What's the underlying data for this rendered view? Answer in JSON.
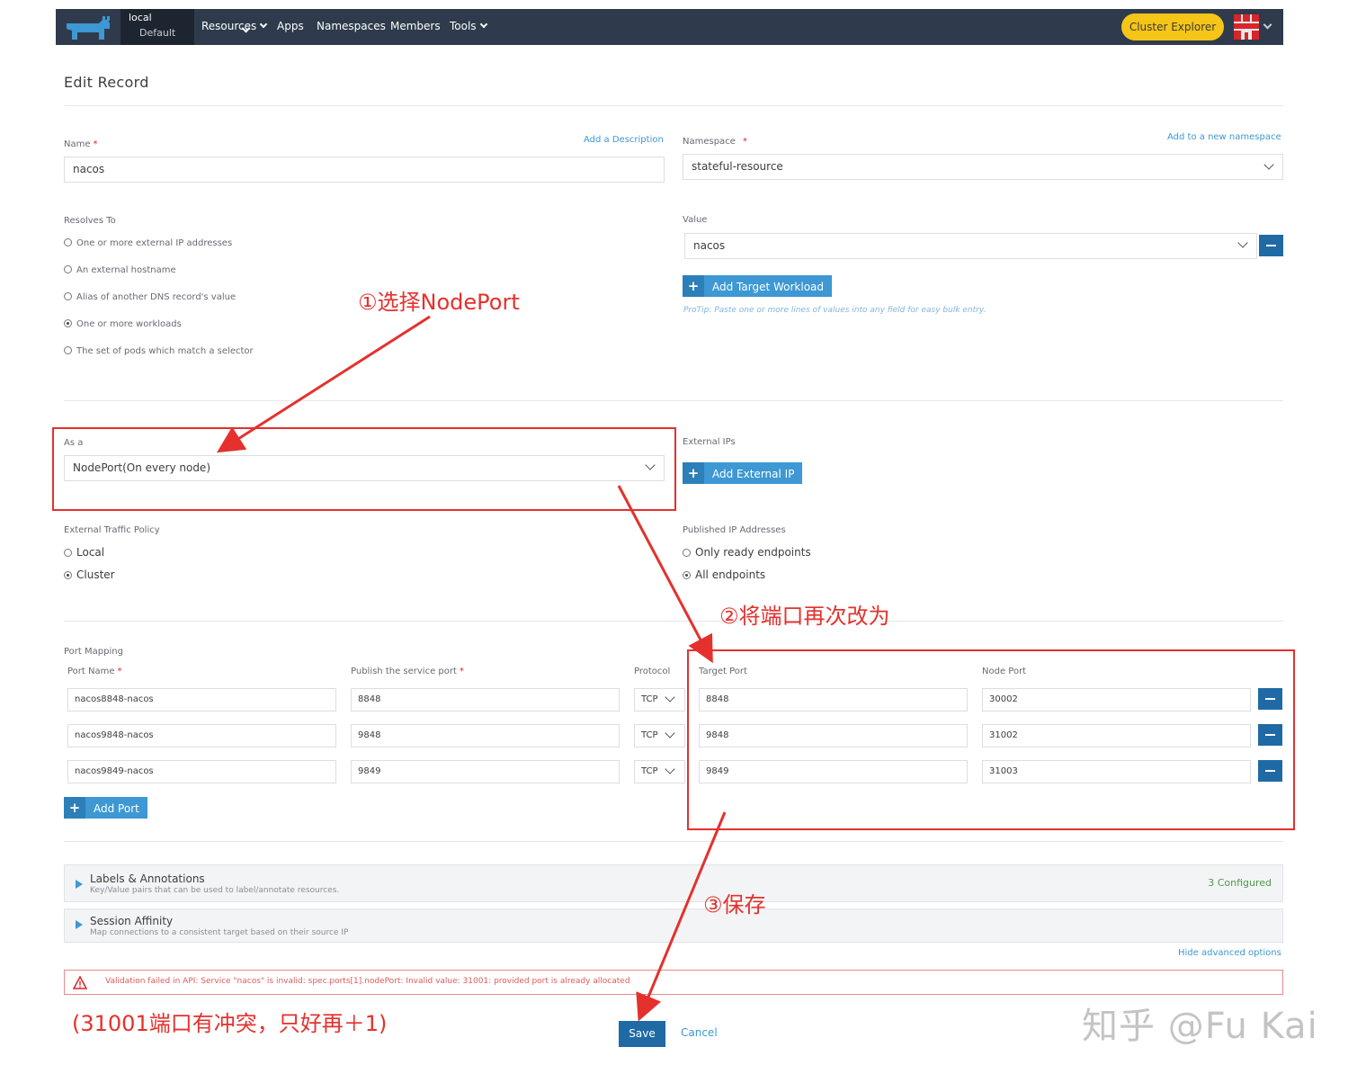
{
  "nav": {
    "cluster": "local",
    "project": "Default",
    "items": [
      "Resources",
      "Apps",
      "Namespaces",
      "Members",
      "Tools"
    ],
    "cluster_explorer": "Cluster Explorer"
  },
  "page": {
    "title": "Edit Record"
  },
  "name": {
    "label": "Name",
    "required": "*",
    "add_description": "Add a Description",
    "value": "nacos"
  },
  "namespace": {
    "label": "Namespace",
    "required": "*",
    "add_link": "Add to a new namespace",
    "value": "stateful-resource"
  },
  "resolves": {
    "label": "Resolves To",
    "options": [
      "One or more external IP addresses",
      "An external hostname",
      "Alias of another DNS record's value",
      "One or more workloads",
      "The set of pods which match a selector"
    ],
    "selected_index": 3
  },
  "value": {
    "label": "Value",
    "selected": "nacos",
    "add_workload": "Add Target Workload",
    "protip": "ProTip: Paste one or more lines of values into any field for easy bulk entry."
  },
  "as_a": {
    "label": "As a",
    "value": "NodePort(On every node)"
  },
  "external_ips": {
    "label": "External IPs",
    "add_button": "Add External IP"
  },
  "traffic_policy": {
    "label": "External Traffic Policy",
    "options": [
      "Local",
      "Cluster"
    ],
    "selected_index": 1
  },
  "published_ips": {
    "label": "Published IP Addresses",
    "options": [
      "Only ready endpoints",
      "All endpoints"
    ],
    "selected_index": 1
  },
  "port_mapping": {
    "label": "Port Mapping",
    "headers": {
      "port_name": "Port Name",
      "publish_port": "Publish the service port",
      "protocol": "Protocol",
      "target_port": "Target Port",
      "node_port": "Node Port",
      "required": "*"
    },
    "rows": [
      {
        "name": "nacos8848-nacos",
        "publish": "8848",
        "protocol": "TCP",
        "target": "8848",
        "node": "30002"
      },
      {
        "name": "nacos9848-nacos",
        "publish": "9848",
        "protocol": "TCP",
        "target": "9848",
        "node": "31002"
      },
      {
        "name": "nacos9849-nacos",
        "publish": "9849",
        "protocol": "TCP",
        "target": "9849",
        "node": "31003"
      }
    ],
    "add_port": "Add Port"
  },
  "labels_panel": {
    "title": "Labels & Annotations",
    "subtitle": "Key/Value pairs that can be used to label/annotate resources.",
    "count": "3 Configured"
  },
  "session_panel": {
    "title": "Session Affinity",
    "subtitle": "Map connections to a consistent target based on their source IP"
  },
  "advanced": {
    "hide_link": "Hide advanced options"
  },
  "error": {
    "message": "Validation failed in API: Service \"nacos\" is invalid: spec.ports[1].nodePort: Invalid value: 31001: provided port is already allocated"
  },
  "actions": {
    "save": "Save",
    "cancel": "Cancel"
  },
  "annotations": {
    "step1": "①选择NodePort",
    "step2": "②将端口再次改为",
    "step3": "③保存",
    "note": "(31001端口有冲突，只好再＋1)",
    "watermark": "知乎 @Fu Kai"
  },
  "colors": {
    "nav_bg": "#2f3b4c",
    "accent_blue": "#3d98d3",
    "dark_blue": "#1f6aa5",
    "annotation_red": "#e4312d",
    "cluster_explorer": "#f5c518",
    "error_red": "#e05a5a",
    "configured_green": "#4e9a4a"
  }
}
